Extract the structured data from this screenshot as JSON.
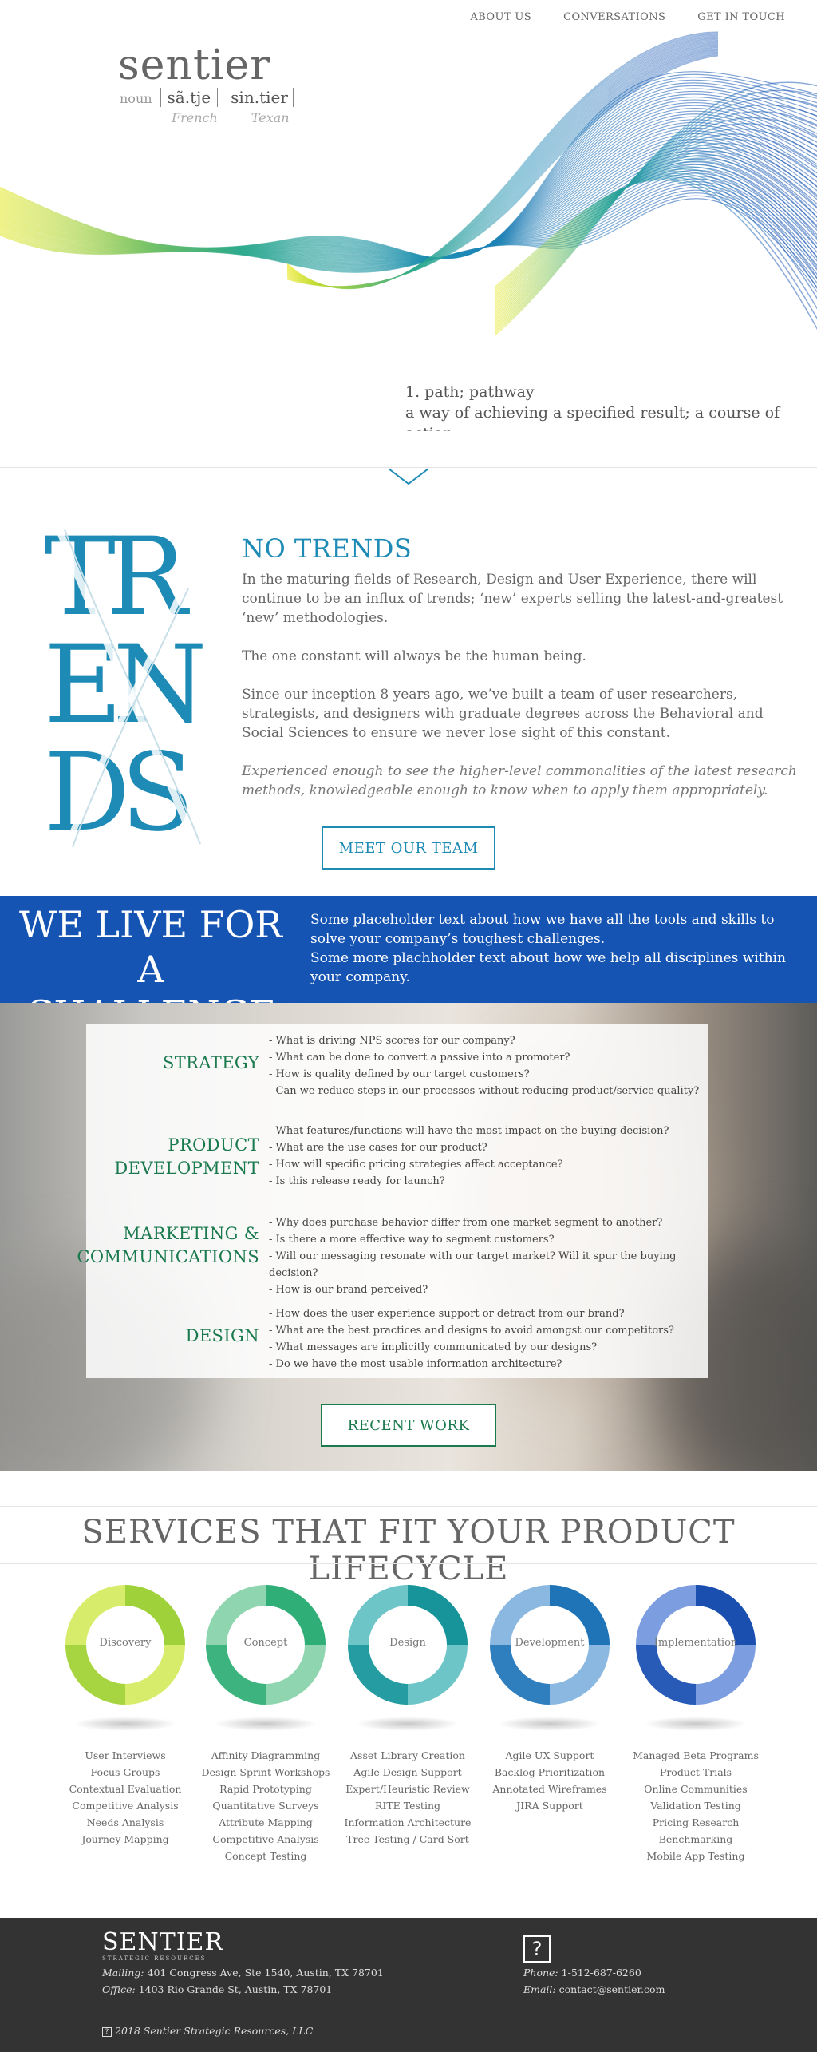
{
  "nav": {
    "items": [
      "ABOUT US",
      "CONVERSATIONS",
      "GET IN TOUCH"
    ]
  },
  "hero": {
    "word": "sentier",
    "pos": "noun",
    "pron_french": "sã.tje",
    "pron_texan": "sin.tier",
    "lang_french": "French",
    "lang_texan": "Texan",
    "def_1": "1.  path; pathway",
    "def_2": "a way of achieving a specified result; a course of action.",
    "wave_colors": [
      "#e8e81a",
      "#2aa88c",
      "#1d8bb5",
      "#1554b2"
    ]
  },
  "trends": {
    "art_rows": [
      "TR",
      "EN",
      "DS"
    ],
    "title": "NO TRENDS",
    "p1": "In the maturing fields of Research, Design and User Experience, there will continue to be an influx of trends; ‘new’ experts selling the latest-and-greatest ‘new’ methodologies.",
    "p2": "The one constant will always be the human being.",
    "p3": "Since our inception 8 years ago, we’ve built a team of user researchers, strategists, and designers with graduate degrees across the Behavioral and Social Sciences to ensure we never lose sight of this constant.",
    "p4": "Experienced enough to see the higher-level commonalities of the latest research methods, knowledgeable enough to know when to apply them appropriately.",
    "button": "MEET OUR TEAM"
  },
  "challenge": {
    "title_1": "WE LIVE FOR",
    "title_2": "A CHALLENGE",
    "text_1": "Some placeholder text about how we have all the tools and skills to solve your company’s toughest challenges.",
    "text_2": "Some more plachholder text about how we help all disciplines within your company."
  },
  "questions": [
    {
      "label_1": "STRATEGY",
      "label_2": "",
      "items": [
        "- What is driving NPS scores for our company?",
        "- What can be done to convert a passive into a promoter?",
        "- How is quality defined by our target customers?",
        "- Can we reduce steps in our processes without reducing product/service quality?"
      ]
    },
    {
      "label_1": "PRODUCT",
      "label_2": "DEVELOPMENT",
      "items": [
        "- What features/functions will have the most impact on the buying decision?",
        "- What are the use cases for our product?",
        "- How will specific pricing strategies affect acceptance?",
        "- Is this release ready for launch?"
      ]
    },
    {
      "label_1": "MARKETING &",
      "label_2": "COMMUNICATIONS",
      "items": [
        "- Why does purchase behavior differ from one market segment to another?",
        "- Is there a more effective way to segment customers?",
        "- Will our messaging resonate with our target market? Will it spur the buying decision?",
        "- How is our brand perceived?"
      ]
    },
    {
      "label_1": "DESIGN",
      "label_2": "",
      "items": [
        "- How does the user experience support or detract from our brand?",
        "- What are the best practices and designs to avoid amongst our competitors?",
        "- What messages are implicitly communicated by our designs?",
        "- Do we have the most usable information architecture?"
      ]
    }
  ],
  "recent_work": "RECENT WORK",
  "services": {
    "title": "SERVICES THAT FIT YOUR PRODUCT LIFECYCLE",
    "stages": [
      {
        "name": "Discovery",
        "color_a": "#9fd13a",
        "color_b": "#d7ec6a",
        "items": [
          "User Interviews",
          "Focus Groups",
          "Contextual Evaluation",
          "Competitive Analysis",
          "Needs Analysis",
          "Journey Mapping"
        ]
      },
      {
        "name": "Concept",
        "color_a": "#2fae77",
        "color_b": "#8fd6b0",
        "items": [
          "Affinity Diagramming",
          "Design Sprint Workshops",
          "Rapid Prototyping",
          "Quantitative Surveys",
          "Attribute Mapping",
          "Competitive Analysis",
          "Concept Testing"
        ]
      },
      {
        "name": "Design",
        "color_a": "#17949a",
        "color_b": "#6dc5c8",
        "items": [
          "Asset Library Creation",
          "Agile Design Support",
          "Expert/Heuristic Review",
          "RITE Testing",
          "Information Architecture",
          "Tree Testing / Card Sort"
        ]
      },
      {
        "name": "Development",
        "color_a": "#1f74b8",
        "color_b": "#8ab8e0",
        "items": [
          "Agile UX Support",
          "Backlog Prioritization",
          "Annotated Wireframes",
          "JIRA Support"
        ]
      },
      {
        "name": "Implementation",
        "color_a": "#1a4fb0",
        "color_b": "#7c9ee0",
        "items": [
          "Managed Beta Programs",
          "Product Trials",
          "Online Communities",
          "Validation Testing",
          "Pricing Research",
          "Benchmarking",
          "Mobile App Testing"
        ]
      }
    ]
  },
  "footer": {
    "logo": "SENTIER",
    "logo_sub": "STRATEGIC RESOURCES",
    "mailing_label": "Mailing:",
    "mailing": "401 Congress Ave, Ste 1540, Austin, TX 78701",
    "office_label": "Office:",
    "office": "1403 Rio Grande St, Austin, TX 78701",
    "phone_label": "Phone:",
    "phone": "1-512-687-6260",
    "email_label": "Email:",
    "email": "contact@sentier.com",
    "copyright": "2018 Sentier Strategic Resources, LLC",
    "mark": "?"
  }
}
